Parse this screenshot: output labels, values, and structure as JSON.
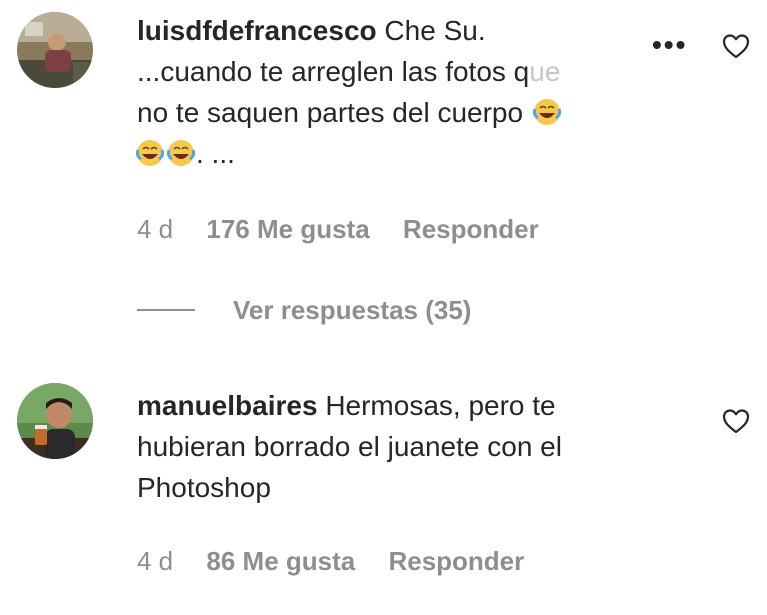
{
  "comments": [
    {
      "username": "luisdfdefrancesco",
      "line1_rest": "Che Su.",
      "line2": "...cuando te arreglen las fotos q",
      "line2_faded": "ue",
      "line3": "no te saquen partes del cuerpo",
      "line4_suffix": ". ...",
      "emoji_name": "face-with-tears-of-joy",
      "time": "4 d",
      "likes": "176 Me gusta",
      "reply": "Responder",
      "more_options": "•••",
      "view_replies": "Ver respuestas (35)"
    },
    {
      "username": "manuelbaires",
      "line1_rest": "Hermosas, pero te",
      "line2": "hubieran borrado el juanete con el",
      "line3": "Photoshop",
      "time": "4 d",
      "likes": "86 Me gusta",
      "reply": "Responder"
    }
  ],
  "colors": {
    "text": "#262626",
    "secondary": "#8e8e8e",
    "faded": "#c7c7c7",
    "background": "#ffffff"
  },
  "icons": [
    "heart-outline-icon",
    "more-options-icon",
    "laughing-emoji-icon"
  ]
}
